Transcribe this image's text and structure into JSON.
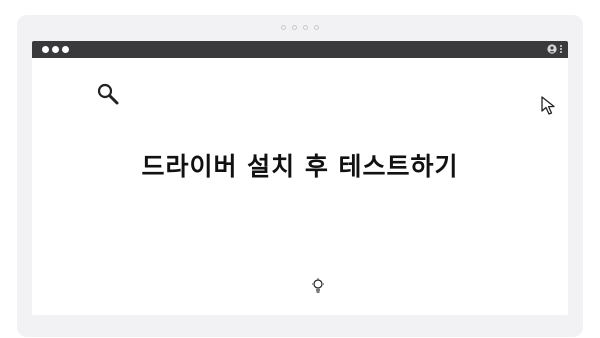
{
  "content": {
    "headline": "드라이버 설치 후 테스트하기"
  },
  "icons": {
    "search": "search-icon",
    "cursor": "cursor-arrow-icon",
    "bulb": "lightbulb-icon",
    "user": "user-icon",
    "menu": "kebab-menu-icon"
  },
  "colors": {
    "titlebar": "#3a3a3c",
    "frame": "#f2f2f4",
    "text": "#111111"
  }
}
